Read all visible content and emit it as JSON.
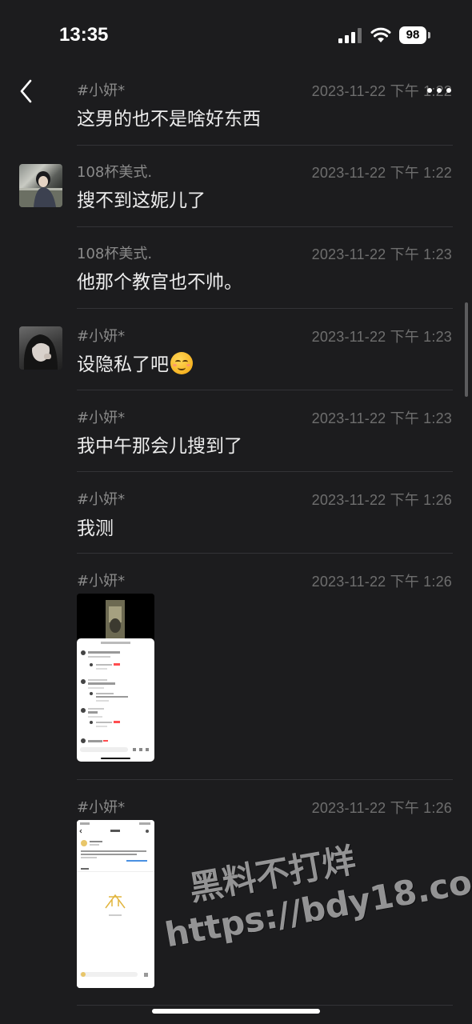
{
  "status_bar": {
    "time": "13:35",
    "battery": "98"
  },
  "messages": [
    {
      "name": "#小妍*",
      "time": "2023-11-22 下午 1:22",
      "text": "这男的也不是啥好东西"
    },
    {
      "name": "108杯美式.",
      "time": "2023-11-22 下午 1:22",
      "text": "搜不到这妮儿了"
    },
    {
      "name": "108杯美式.",
      "time": "2023-11-22 下午 1:23",
      "text": "他那个教官也不帅。"
    },
    {
      "name": "#小妍*",
      "time": "2023-11-22 下午 1:23",
      "text": "设隐私了吧"
    },
    {
      "name": "#小妍*",
      "time": "2023-11-22 下午 1:23",
      "text": "我中午那会儿搜到了"
    },
    {
      "name": "#小妍*",
      "time": "2023-11-22 下午 1:26",
      "text": "我测"
    },
    {
      "name": "#小妍*",
      "time": "2023-11-22 下午 1:26"
    },
    {
      "name": "#小妍*",
      "time": "2023-11-22 下午 1:26"
    }
  ],
  "watermark": {
    "line1": "黑料不打烊",
    "line2": "https://bdy18.co"
  }
}
